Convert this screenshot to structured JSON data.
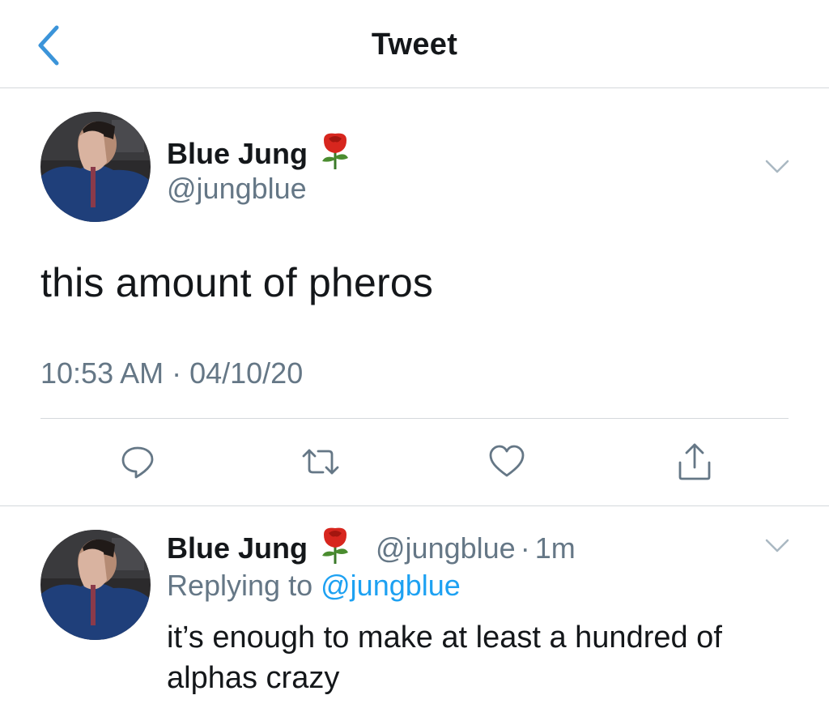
{
  "header": {
    "title": "Tweet",
    "back_icon": "chevron-left-icon"
  },
  "tweet": {
    "author_name": "Blue Jung",
    "author_emoji": "rose-icon",
    "author_handle": "@jungblue",
    "text": "this amount of pheros",
    "timestamp": "10:53 AM · 04/10/20",
    "actions": [
      "reply-icon",
      "retweet-icon",
      "like-icon",
      "share-icon"
    ]
  },
  "reply": {
    "author_name": "Blue Jung",
    "author_emoji": "rose-icon",
    "author_handle": "@jungblue",
    "separator": "·",
    "age": "1m",
    "replying_prefix": "Replying to",
    "replying_to": "@jungblue",
    "text": "it’s enough to make at least a hundred of alphas crazy"
  },
  "colors": {
    "accent": "#1da1f2",
    "back_arrow": "#3b94d9",
    "secondary_text": "#657786",
    "divider": "#d4d8dc"
  }
}
